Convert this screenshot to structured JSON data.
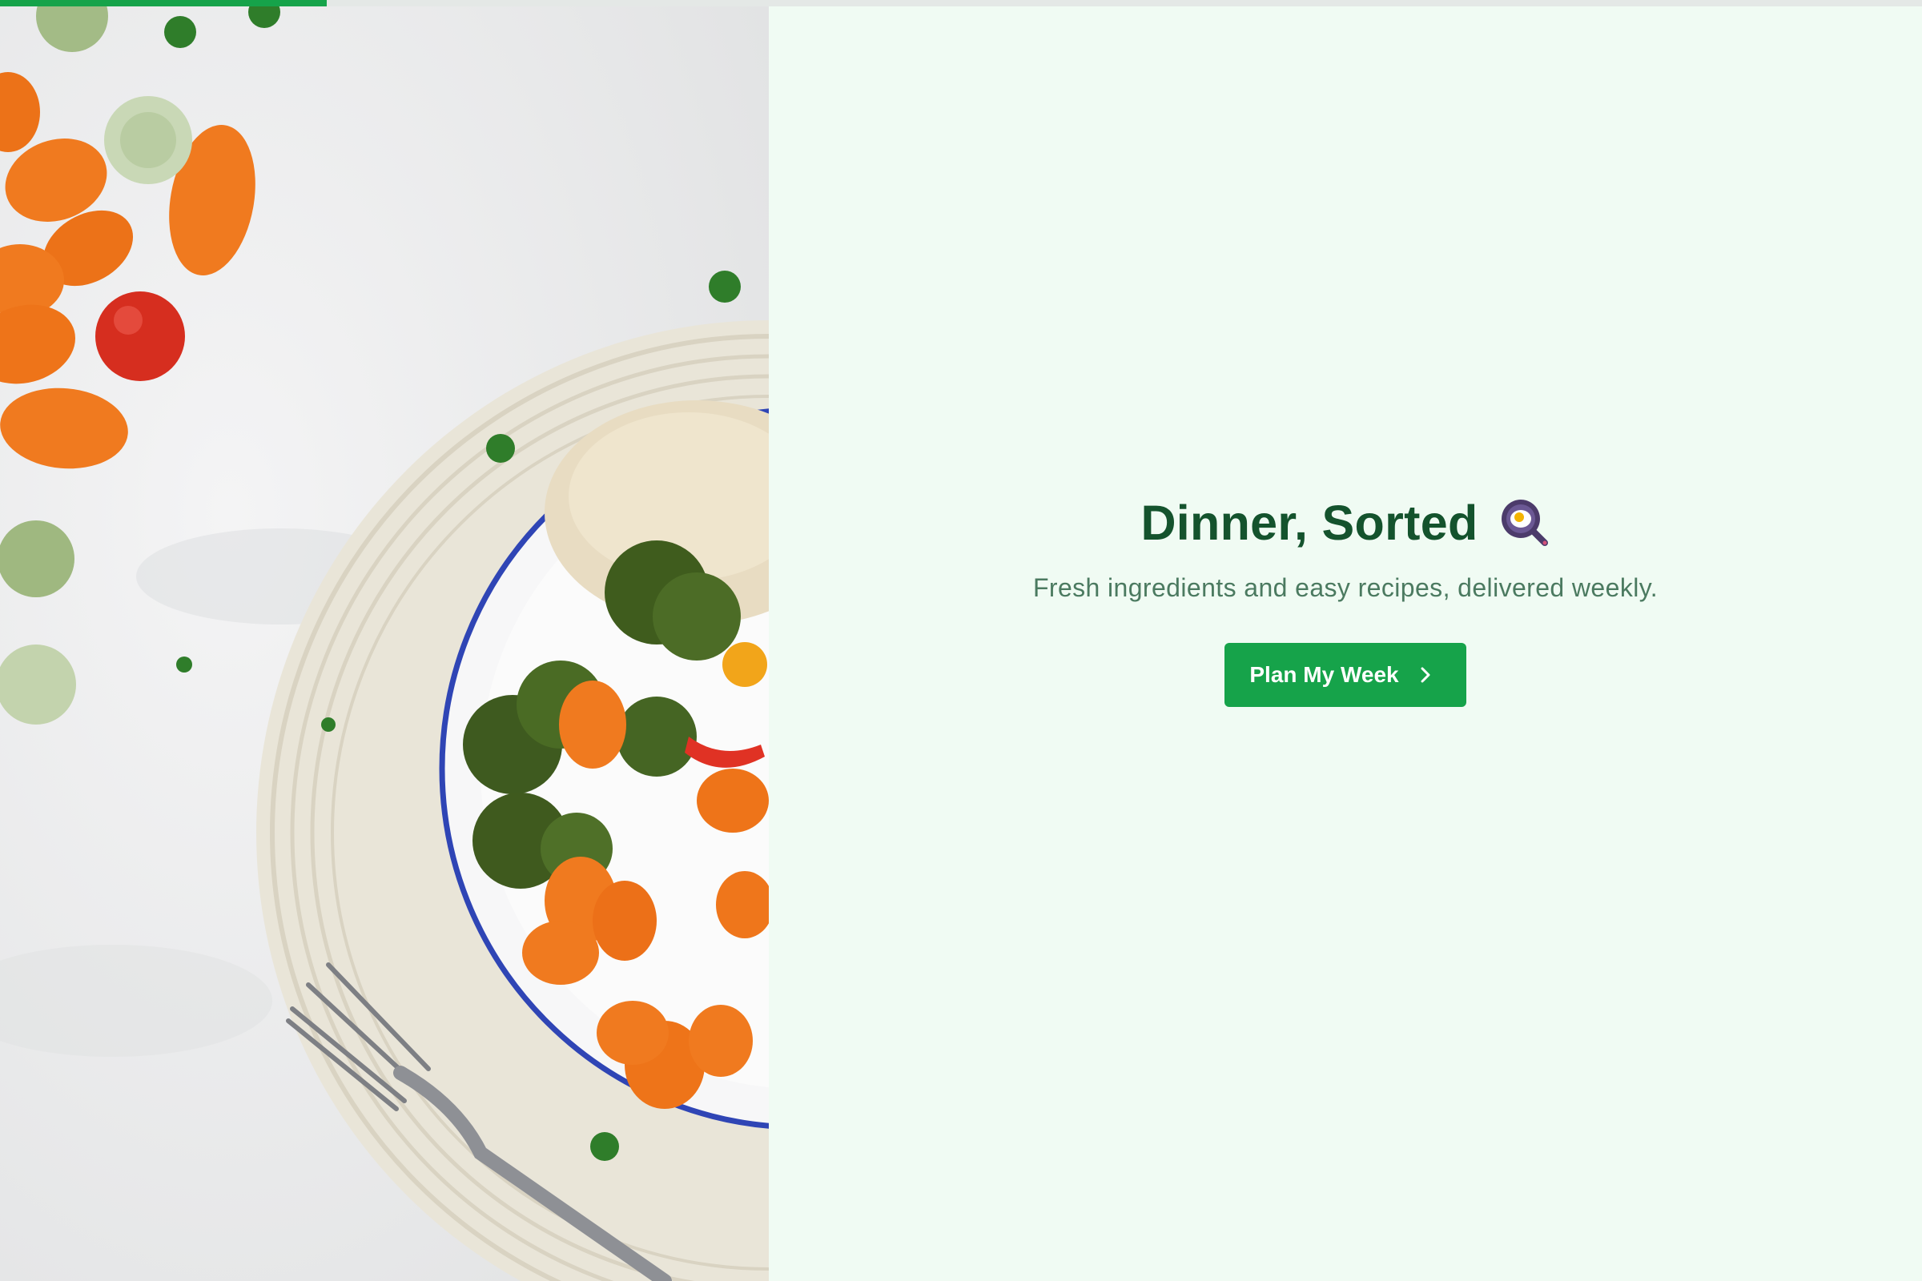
{
  "progress": {
    "fraction": 0.17
  },
  "hero_image": {
    "icon": "food-bowl-photo",
    "description_icon": "fork-icon"
  },
  "hero": {
    "title": "Dinner, Sorted",
    "title_icon": "frying-pan-egg-icon",
    "subtitle": "Fresh ingredients and easy recipes, delivered weekly.",
    "cta_label": "Plan My Week",
    "cta_icon": "chevron-right-icon"
  },
  "colors": {
    "accent": "#16a34a",
    "heading": "#14532d",
    "subtitle": "#4b7a60",
    "background": "#f0fbf3"
  }
}
